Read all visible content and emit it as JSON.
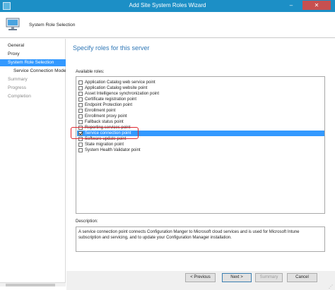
{
  "window": {
    "title": "Add Site System Roles Wizard",
    "minimize_glyph": "–",
    "close_glyph": "✕"
  },
  "header": {
    "page_name": "System Role Selection"
  },
  "nav": [
    {
      "label": "General",
      "state": "normal"
    },
    {
      "label": "Proxy",
      "state": "normal"
    },
    {
      "label": "System Role Selection",
      "state": "active"
    },
    {
      "label": "Service Connection Mode",
      "state": "sub"
    },
    {
      "label": "Summary",
      "state": "disabled"
    },
    {
      "label": "Progress",
      "state": "disabled"
    },
    {
      "label": "Completion",
      "state": "disabled"
    }
  ],
  "content": {
    "heading": "Specify roles for this server",
    "roles_label": "Available roles:",
    "roles": [
      {
        "label": "Application Catalog web service point",
        "checked": false,
        "selected": false
      },
      {
        "label": "Application Catalog website point",
        "checked": false,
        "selected": false
      },
      {
        "label": "Asset Intelligence synchronization point",
        "checked": false,
        "selected": false
      },
      {
        "label": "Certificate registration point",
        "checked": false,
        "selected": false
      },
      {
        "label": "Endpoint Protection point",
        "checked": false,
        "selected": false
      },
      {
        "label": "Enrollment point",
        "checked": false,
        "selected": false
      },
      {
        "label": "Enrollment proxy point",
        "checked": false,
        "selected": false
      },
      {
        "label": "Fallback status point",
        "checked": false,
        "selected": false
      },
      {
        "label": "Reporting services point",
        "checked": false,
        "selected": false
      },
      {
        "label": "Service connection point",
        "checked": true,
        "selected": true
      },
      {
        "label": "Software update point",
        "checked": false,
        "selected": false
      },
      {
        "label": "State migration point",
        "checked": false,
        "selected": false
      },
      {
        "label": "System Health Validator point",
        "checked": false,
        "selected": false
      }
    ],
    "description_label": "Description:",
    "description": "A service connection point connects Configuration Manger to Microsoft cloud services and is used for Microsoft Intune subscription and servicing, and to update your Configuration Manager installation."
  },
  "buttons": {
    "previous": "< Previous",
    "next": "Next >",
    "summary": "Summary",
    "cancel": "Cancel"
  },
  "colors": {
    "titlebar": "#1c8fc6",
    "selection": "#3399ff",
    "heading": "#2f77b6",
    "highlight_outline": "#e0262d"
  }
}
